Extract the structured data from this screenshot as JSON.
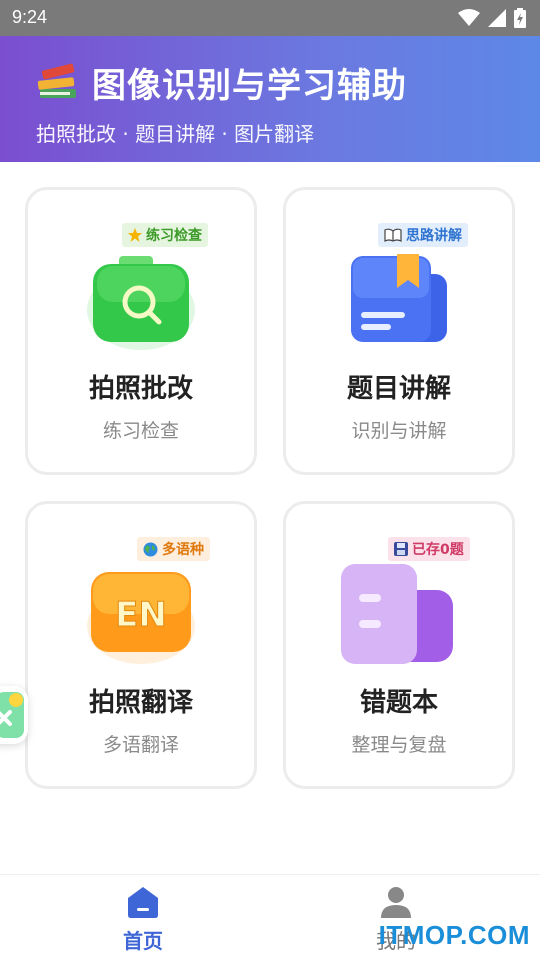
{
  "status_bar": {
    "time": "9:24"
  },
  "header": {
    "title": "图像识别与学习辅助",
    "subtitle": "拍照批改 · 题目讲解 · 图片翻译",
    "icon": "books-icon"
  },
  "cards": [
    {
      "title": "拍照批改",
      "subtitle": "练习检查",
      "badge": "练习检查",
      "badge_icon": "star-icon",
      "icon": "camera-search-icon",
      "accent": "#2fc94a"
    },
    {
      "title": "题目讲解",
      "subtitle": "识别与讲解",
      "badge": "思路讲解",
      "badge_icon": "book-open-icon",
      "icon": "book-bookmark-icon",
      "accent": "#4a6cf0"
    },
    {
      "title": "拍照翻译",
      "subtitle": "多语翻译",
      "badge": "多语种",
      "badge_icon": "globe-icon",
      "icon": "translate-en-icon",
      "accent": "#ff9a1a"
    },
    {
      "title": "错题本",
      "subtitle": "整理与复盘",
      "badge": "已存0题",
      "badge_icon": "floppy-disk-icon",
      "icon": "notebook-icon",
      "accent": "#b77df0"
    }
  ],
  "bottom_nav": [
    {
      "label": "首页",
      "icon": "home-icon",
      "active": true
    },
    {
      "label": "我的",
      "icon": "user-icon",
      "active": false
    }
  ],
  "watermark": "ITMOP.COM"
}
